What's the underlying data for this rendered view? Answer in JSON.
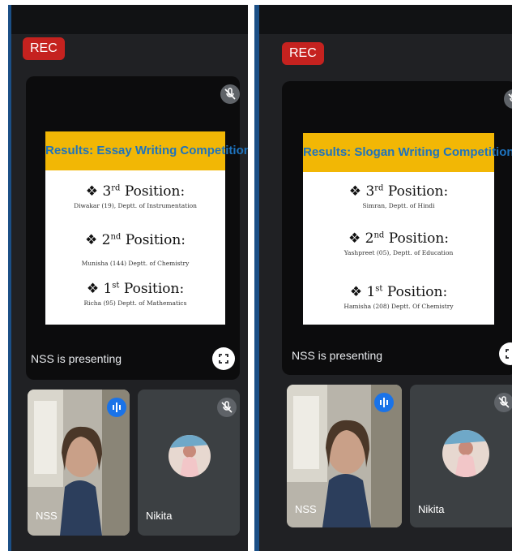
{
  "panels": [
    {
      "rec_label": "REC",
      "slide": {
        "title": "Results: Essay Writing Competition",
        "positions": [
          {
            "num": "3",
            "suffix": "rd",
            "word": "Position:",
            "detail": "Diwakar (19), Deptt. of Instrumentation"
          },
          {
            "num": "2",
            "suffix": "nd",
            "word": "Position:",
            "detail": "Munisha (144) Deptt. of Chemistry"
          },
          {
            "num": "1",
            "suffix": "st",
            "word": "Position:",
            "detail": "Richa (95) Deptt. of Mathematics"
          }
        ]
      },
      "presenting_label": "NSS is presenting",
      "tiles": [
        {
          "name": "NSS"
        },
        {
          "name": "Nikita"
        }
      ]
    },
    {
      "rec_label": "REC",
      "slide": {
        "title": "Results: Slogan Writing Competition",
        "positions": [
          {
            "num": "3",
            "suffix": "rd",
            "word": "Position:",
            "detail": "Simran, Deptt. of Hindi"
          },
          {
            "num": "2",
            "suffix": "nd",
            "word": "Position:",
            "detail": "Yashpreet (05), Deptt. of Education"
          },
          {
            "num": "1",
            "suffix": "st",
            "word": "Position:",
            "detail": "Hamisha (208) Deptt. Of Chemistry"
          }
        ]
      },
      "presenting_label": "NSS is presenting",
      "tiles": [
        {
          "name": "NSS"
        },
        {
          "name": "Nikita"
        }
      ]
    }
  ],
  "colors": {
    "accent_border": "#1b4f86",
    "rec_red": "#c5221f",
    "slide_title_bg": "#f2b705",
    "slide_title_text": "#1e73be",
    "speaking_blue": "#1a73e8"
  },
  "icons": [
    "mic-off-icon",
    "fullscreen-icon",
    "speaking-indicator-icon"
  ]
}
